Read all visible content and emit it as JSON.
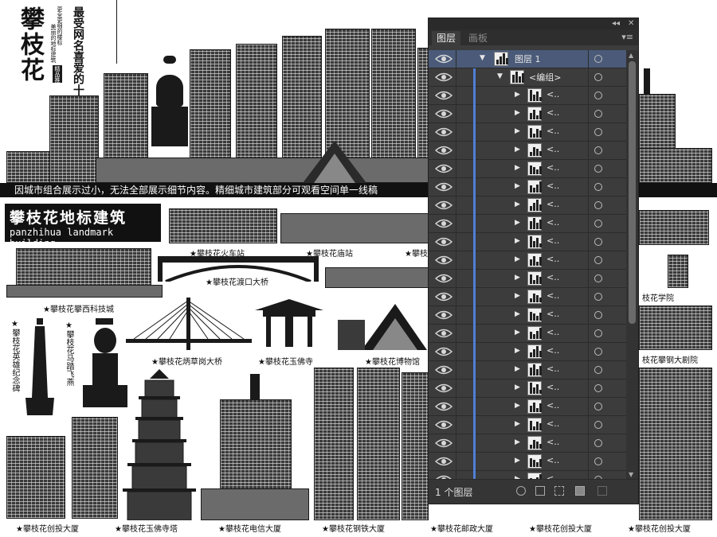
{
  "poster": {
    "title": "攀枝花",
    "subtitle_main": "最受网名喜爱的十大",
    "subtitle_small_1": "更全更细的楼标",
    "subtitle_small_2": "美丽的地标建筑",
    "badge": "精品推荐",
    "notice": "因城市组合展示过小，无法全部展示细节内容。精细城市建筑部分可观看空间单一线稿",
    "brand_cn": "攀枝花地标建筑",
    "brand_en": "panzhihua landmark building",
    "captions": {
      "train_station": "★攀枝花火车站",
      "temple_top": "★攀枝花庙站",
      "top_right_cut": "★攀枝",
      "panxi_tech": "★攀枝花攀西科技城",
      "dukou_bridge": "★攀枝花渡口大桥",
      "bingcaogang_bridge": "★攀枝花炳草岗大桥",
      "yufo_temple": "★攀枝花玉佛寺",
      "museum": "★攀枝花博物馆",
      "hero_monument": "★攀枝花英雄纪念碑",
      "horse_statue": "★攀枝花马踏飞燕",
      "college": "枝花学院",
      "theater": "枝花攀钢大剧院",
      "chuangtou_1": "★攀枝花创投大厦",
      "yufo_pagoda": "★攀枝花玉佛寺塔",
      "telecom": "★攀枝花电信大厦",
      "steel": "★攀枝花钢铁大厦",
      "post": "★攀枝花邮政大厦",
      "chuangtou_2": "★攀枝花创投大厦",
      "chuangtou_3": "★攀枝花创投大厦"
    }
  },
  "layers_panel": {
    "tabs": [
      {
        "label": "图层",
        "active": true
      },
      {
        "label": "画板",
        "active": false
      }
    ],
    "collapse_glyph": "◂◂",
    "close_glyph": "✕",
    "menu_glyph": "▾≡",
    "layer_name": "图层 1",
    "group_name": "<编组>",
    "child_label": "<..",
    "child_count": 22,
    "footer_count": "1 个图层",
    "accent_color": "#4f7fd6"
  }
}
